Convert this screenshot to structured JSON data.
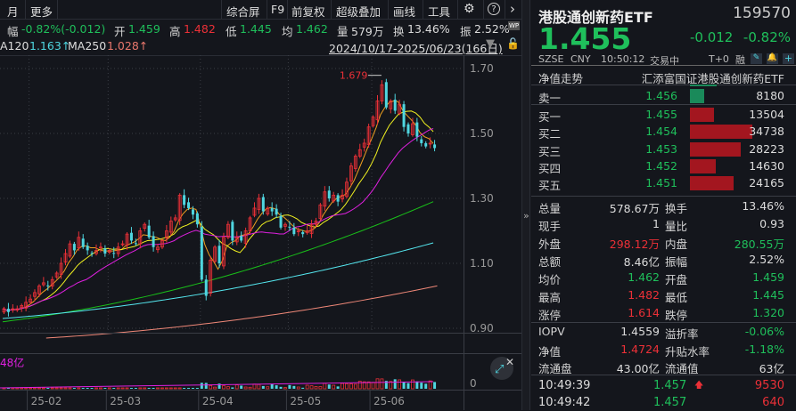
{
  "toolbar": {
    "left": [
      "月",
      "更多"
    ],
    "right": [
      "综合屏",
      "F9",
      "前复权",
      "超级叠加",
      "画线",
      "工具"
    ],
    "gear": "⚙",
    "help": "?",
    "next": "›"
  },
  "stats": {
    "change_label": "幅",
    "change": "-0.82%(-0.012)",
    "open_label": "开",
    "open": "1.459",
    "high_label": "高",
    "high": "1.482",
    "low_label": "低",
    "low": "1.445",
    "avg_label": "均",
    "avg": "1.462",
    "vol_label": "量",
    "vol": "579万",
    "turn_label": "换",
    "turn": "13.46%",
    "amp_label": "振",
    "amp": "2.52%",
    "wp": "WP"
  },
  "ma_legend": {
    "ma120_label": "A120",
    "ma120": "1.163↑",
    "ma250_label": "MA250",
    "ma250": "1.028↑",
    "range": "2024/10/17-2025/06/23(166日)"
  },
  "chart_data": {
    "type": "candlestick",
    "y_ticks": [
      "1.70",
      "1.50",
      "1.30",
      "1.10",
      "0.90"
    ],
    "y_values": [
      1.7,
      1.5,
      1.3,
      1.1,
      0.9
    ],
    "x_ticks": [
      "25-02",
      "25-03",
      "25-04",
      "25-05",
      "25-06"
    ],
    "x_tick_index": [
      6,
      24,
      45,
      65,
      84
    ],
    "high_marker": "1.679",
    "closes": [
      0.96,
      0.95,
      0.96,
      0.96,
      0.97,
      0.98,
      0.99,
      1.01,
      1.03,
      1.04,
      1.03,
      1.05,
      1.07,
      1.1,
      1.13,
      1.16,
      1.14,
      1.18,
      1.15,
      1.14,
      1.13,
      1.14,
      1.15,
      1.13,
      1.14,
      1.13,
      1.15,
      1.16,
      1.19,
      1.17,
      1.16,
      1.2,
      1.22,
      1.18,
      1.15,
      1.15,
      1.17,
      1.2,
      1.23,
      1.24,
      1.31,
      1.28,
      1.27,
      1.25,
      1.22,
      1.05,
      1.0,
      1.11,
      1.15,
      1.1,
      1.18,
      1.22,
      1.17,
      1.18,
      1.17,
      1.2,
      1.24,
      1.27,
      1.3,
      1.26,
      1.27,
      1.26,
      1.25,
      1.21,
      1.22,
      1.21,
      1.19,
      1.2,
      1.19,
      1.2,
      1.22,
      1.23,
      1.28,
      1.32,
      1.3,
      1.31,
      1.29,
      1.31,
      1.35,
      1.4,
      1.43,
      1.45,
      1.47,
      1.52,
      1.55,
      1.6,
      1.65,
      1.58,
      1.6,
      1.57,
      1.59,
      1.52,
      1.5,
      1.53,
      1.49,
      1.47,
      1.46,
      1.47,
      1.455
    ],
    "ma60": [
      0.92,
      1.29
    ],
    "ma120": [
      0.93,
      1.163
    ],
    "ma250": [
      0.87,
      1.028
    ],
    "volume_label": "48亿",
    "volume_zero": "0"
  },
  "quote": {
    "name": "港股通创新药ETF",
    "code": "159570",
    "price": "1.455",
    "change": "-0.012",
    "pct": "-0.82%",
    "exchange": "SZSE",
    "currency": "CNY",
    "time": "10:50:12",
    "status": "交易中",
    "t0": "T+0",
    "margin": "融"
  },
  "nav_row": {
    "label": "净值走势",
    "fund": "汇添富国证港股通创新药ETF"
  },
  "asks": [
    {
      "label": "卖一",
      "price": "1.456",
      "vol": "8180",
      "qty": 8180
    }
  ],
  "bids": [
    {
      "label": "买一",
      "price": "1.455",
      "vol": "13504",
      "qty": 13504
    },
    {
      "label": "买二",
      "price": "1.454",
      "vol": "34738",
      "qty": 34738
    },
    {
      "label": "买三",
      "price": "1.453",
      "vol": "28223",
      "qty": 28223
    },
    {
      "label": "买四",
      "price": "1.452",
      "vol": "14630",
      "qty": 14630
    },
    {
      "label": "买五",
      "price": "1.451",
      "vol": "24165",
      "qty": 24165
    }
  ],
  "details": [
    {
      "l1": "总量",
      "v1": "578.67万",
      "c1": "w",
      "l2": "换手",
      "v2": "13.46%",
      "c2": "w"
    },
    {
      "l1": "现手",
      "v1": "1",
      "c1": "w",
      "l2": "量比",
      "v2": "0.93",
      "c2": "w"
    },
    {
      "l1": "外盘",
      "v1": "298.12万",
      "c1": "r",
      "l2": "内盘",
      "v2": "280.55万",
      "c2": "g"
    },
    {
      "l1": "总额",
      "v1": "8.46亿",
      "c1": "w",
      "l2": "振幅",
      "v2": "2.52%",
      "c2": "w"
    },
    {
      "l1": "均价",
      "v1": "1.462",
      "c1": "g",
      "l2": "开盘",
      "v2": "1.459",
      "c2": "g"
    },
    {
      "l1": "最高",
      "v1": "1.482",
      "c1": "r",
      "l2": "最低",
      "v2": "1.445",
      "c2": "g"
    },
    {
      "l1": "涨停",
      "v1": "1.614",
      "c1": "r",
      "l2": "跌停",
      "v2": "1.320",
      "c2": "g"
    }
  ],
  "fund": [
    {
      "l1": "IOPV",
      "v1": "1.4559",
      "c1": "w",
      "l2": "溢折率",
      "v2": "-0.06%",
      "c2": "g"
    },
    {
      "l1": "净值",
      "v1": "1.4724",
      "c1": "r",
      "l2": "升贴水率",
      "v2": "-1.18%",
      "c2": "g"
    },
    {
      "l1": "流通盘",
      "v1": "43.00亿",
      "c1": "w",
      "l2": "流通值",
      "v2": "63亿",
      "c2": "w"
    }
  ],
  "ticks": [
    {
      "time": "10:49:39",
      "price": "1.457",
      "arrow": "🡅",
      "vol": "9530"
    },
    {
      "time": "10:49:42",
      "price": "1.457",
      "arrow": "",
      "vol": "640"
    }
  ],
  "colors": {
    "up": "#eb3037",
    "down": "#4fd6e0",
    "green": "#1fbf5b",
    "ask_bar": "#1a8a5a",
    "bid_bar": "#a3161f"
  }
}
